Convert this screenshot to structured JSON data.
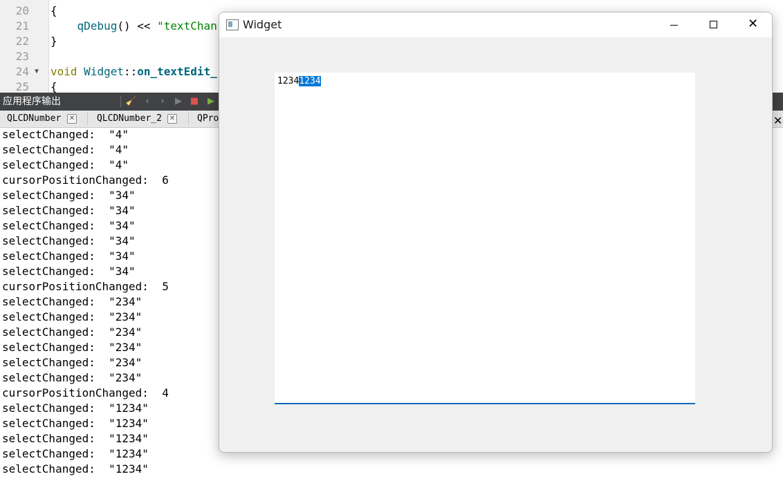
{
  "editor": {
    "lines": [
      {
        "num": "20",
        "segments": [
          {
            "t": "{",
            "c": "op"
          }
        ]
      },
      {
        "num": "21",
        "segments": [
          {
            "t": "    ",
            "c": "op"
          },
          {
            "t": "qDebug",
            "c": "fn"
          },
          {
            "t": "() << ",
            "c": "op"
          },
          {
            "t": "\"textChan",
            "c": "str"
          }
        ]
      },
      {
        "num": "22",
        "segments": [
          {
            "t": "}",
            "c": "op"
          }
        ]
      },
      {
        "num": "23",
        "segments": []
      },
      {
        "num": "24",
        "segments": [
          {
            "t": "void",
            "c": "kw"
          },
          {
            "t": " ",
            "c": "op"
          },
          {
            "t": "Widget",
            "c": "fn"
          },
          {
            "t": "::",
            "c": "op"
          },
          {
            "t": "on_textEdit_",
            "c": "fnb"
          }
        ]
      },
      {
        "num": "25",
        "segments": [
          {
            "t": "{",
            "c": "op"
          }
        ]
      }
    ]
  },
  "output_pane": {
    "title": "应用程序输出",
    "tabs": [
      {
        "label": "QLCDNumber"
      },
      {
        "label": "QLCDNumber_2"
      },
      {
        "label": "QProc"
      }
    ],
    "log": [
      "selectChanged:  \"4\"",
      "selectChanged:  \"4\"",
      "selectChanged:  \"4\"",
      "cursorPositionChanged:  6",
      "selectChanged:  \"34\"",
      "selectChanged:  \"34\"",
      "selectChanged:  \"34\"",
      "selectChanged:  \"34\"",
      "selectChanged:  \"34\"",
      "selectChanged:  \"34\"",
      "cursorPositionChanged:  5",
      "selectChanged:  \"234\"",
      "selectChanged:  \"234\"",
      "selectChanged:  \"234\"",
      "selectChanged:  \"234\"",
      "selectChanged:  \"234\"",
      "selectChanged:  \"234\"",
      "cursorPositionChanged:  4",
      "selectChanged:  \"1234\"",
      "selectChanged:  \"1234\"",
      "selectChanged:  \"1234\"",
      "selectChanged:  \"1234\"",
      "selectChanged:  \"1234\""
    ]
  },
  "widget_window": {
    "title": "Widget",
    "text_edit": {
      "plain_text": "1234",
      "selected_text": "1234"
    }
  },
  "colors": {
    "selection": "#0078d7",
    "output_toolbar": "#404244",
    "focus_underline": "#0067c0"
  }
}
